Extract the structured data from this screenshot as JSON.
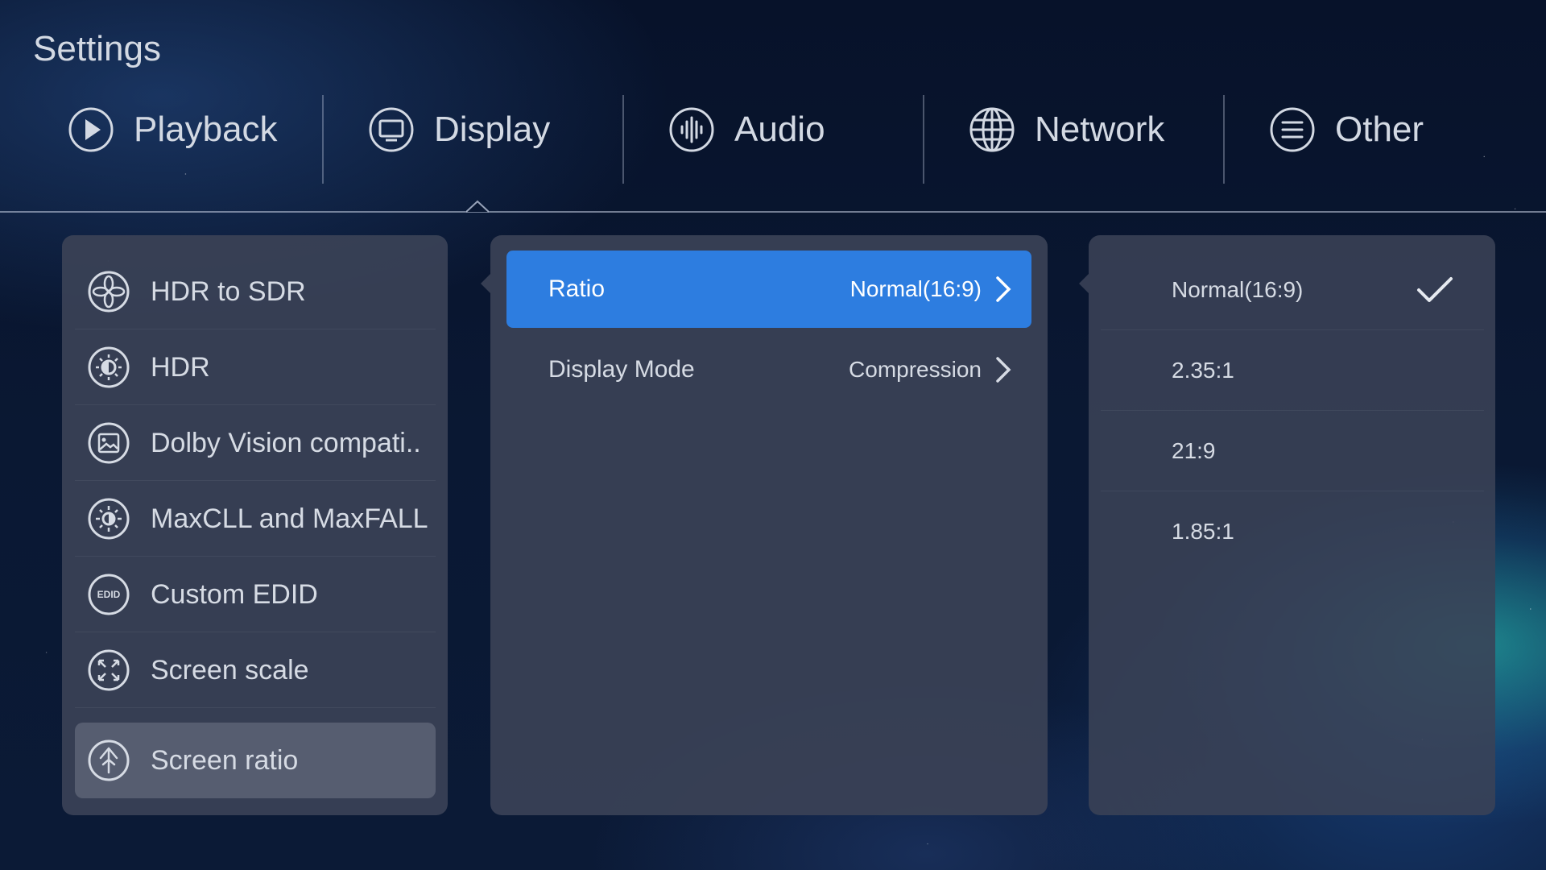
{
  "app": {
    "title": "Settings"
  },
  "tabs": [
    {
      "label": "Playback",
      "icon": "play-icon"
    },
    {
      "label": "Display",
      "icon": "monitor-icon",
      "active": true
    },
    {
      "label": "Audio",
      "icon": "audio-wave-icon"
    },
    {
      "label": "Network",
      "icon": "globe-icon"
    },
    {
      "label": "Other",
      "icon": "menu-icon"
    }
  ],
  "menu": {
    "items": [
      {
        "label": "HDR to SDR",
        "icon": "aperture-icon"
      },
      {
        "label": "HDR",
        "icon": "hdr-sun-icon"
      },
      {
        "label": "Dolby Vision compati..",
        "icon": "image-icon"
      },
      {
        "label": "MaxCLL and MaxFALL",
        "icon": "brightness-icon"
      },
      {
        "label": "Custom EDID",
        "icon": "edid-icon",
        "badge": "EDID"
      },
      {
        "label": "Screen scale",
        "icon": "expand-icon"
      },
      {
        "label": "Screen ratio",
        "icon": "ratio-icon",
        "selected": true
      }
    ]
  },
  "options": [
    {
      "label": "Ratio",
      "value": "Normal(16:9)",
      "selected": true
    },
    {
      "label": "Display Mode",
      "value": "Compression"
    }
  ],
  "choices": [
    {
      "label": "Normal(16:9)",
      "checked": true
    },
    {
      "label": "2.35:1"
    },
    {
      "label": "21:9"
    },
    {
      "label": "1.85:1"
    }
  ],
  "colors": {
    "accent": "#2d7de0",
    "panel": "#3a4256",
    "menu_selected": "#565d70"
  }
}
